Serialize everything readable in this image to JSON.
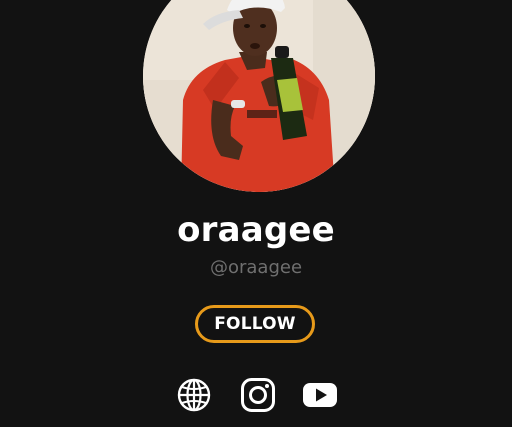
{
  "profile": {
    "display_name": "oraagee",
    "handle": "@oraagee",
    "avatar_alt": "profile photo"
  },
  "actions": {
    "follow_label": "FOLLOW"
  },
  "socials": [
    {
      "icon": "globe-icon"
    },
    {
      "icon": "instagram-icon"
    },
    {
      "icon": "youtube-icon"
    }
  ],
  "colors": {
    "background": "#121212",
    "accent": "#e79a1a",
    "name": "#ffffff",
    "handle": "#6f6f6f"
  }
}
